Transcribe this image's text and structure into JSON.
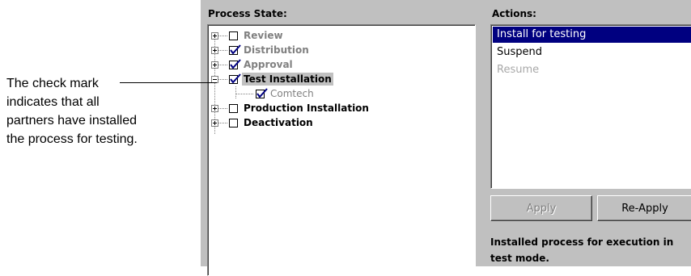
{
  "callout": {
    "lines": [
      "The check mark",
      "indicates that all",
      "partners have installed",
      "the process for testing."
    ]
  },
  "process_state": {
    "label": "Process State:",
    "nodes": [
      {
        "label": "Review",
        "checked": false,
        "expanded": false
      },
      {
        "label": "Distribution",
        "checked": true,
        "expanded": false
      },
      {
        "label": "Approval",
        "checked": true,
        "expanded": false
      },
      {
        "label": "Test Installation",
        "checked": true,
        "expanded": true,
        "selected": true,
        "children": [
          {
            "label": "Comtech",
            "checked": true
          }
        ]
      },
      {
        "label": "Production Installation",
        "checked": false,
        "expanded": false
      },
      {
        "label": "Deactivation",
        "checked": false,
        "expanded": false
      }
    ]
  },
  "actions": {
    "label": "Actions:",
    "items": [
      {
        "label": "Install for testing",
        "state": "selected"
      },
      {
        "label": "Suspend",
        "state": "enabled"
      },
      {
        "label": "Resume",
        "state": "disabled"
      }
    ]
  },
  "buttons": {
    "apply": "Apply",
    "reapply": "Re-Apply"
  },
  "status": {
    "line1": "Installed process for execution in",
    "line2": "test mode."
  },
  "colors": {
    "selection": "#000080",
    "checkmark": "#000080",
    "panel": "#c0c0c0"
  }
}
